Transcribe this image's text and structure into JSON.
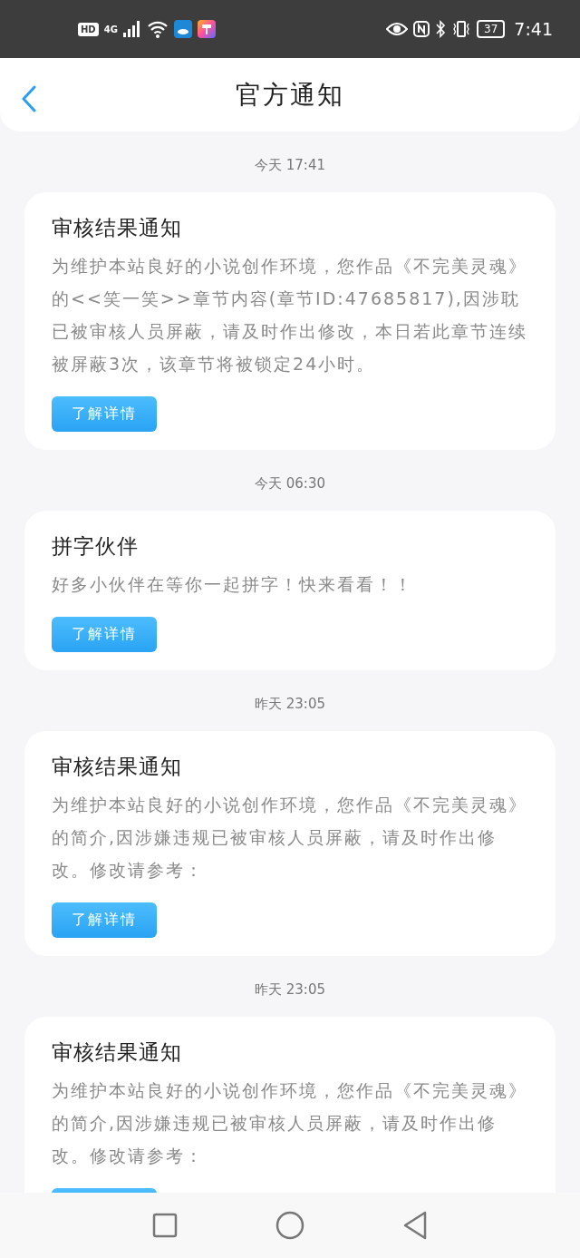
{
  "status_bar": {
    "time": "7:41",
    "battery": "37",
    "network": "4G",
    "hd": "HD"
  },
  "header": {
    "title": "官方通知"
  },
  "messages": [
    {
      "time": "今天 17:41",
      "title": "审核结果通知",
      "body": "为维护本站良好的小说创作环境，您作品《不完美灵魂》的<<笑一笑>>章节内容(章节ID:47685817),因涉耽已被审核人员屏蔽，请及时作出修改，本日若此章节连续被屏蔽3次，该章节将被锁定24小时。",
      "button": "了解详情"
    },
    {
      "time": "今天 06:30",
      "title": "拼字伙伴",
      "body": "好多小伙伴在等你一起拼字！快来看看！！",
      "button": "了解详情"
    },
    {
      "time": "昨天 23:05",
      "title": "审核结果通知",
      "body": "为维护本站良好的小说创作环境，您作品《不完美灵魂》的简介,因涉嫌违规已被审核人员屏蔽，请及时作出修改。修改请参考：",
      "button": "了解详情"
    },
    {
      "time": "昨天 23:05",
      "title": "审核结果通知",
      "body": "为维护本站良好的小说创作环境，您作品《不完美灵魂》的简介,因涉嫌违规已被审核人员屏蔽，请及时作出修改。修改请参考：",
      "button_cut": true
    }
  ]
}
